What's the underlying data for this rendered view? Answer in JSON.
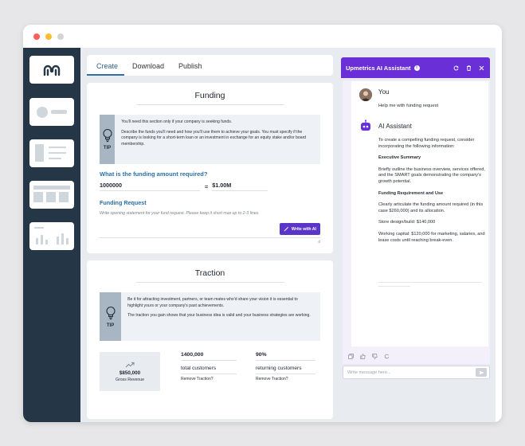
{
  "window": {
    "controls": [
      {
        "name": "close",
        "color": "#ff5f57"
      },
      {
        "name": "minimize",
        "color": "#febc2e"
      },
      {
        "name": "zoom",
        "color": "#d4d4d4"
      }
    ]
  },
  "tabs": [
    {
      "label": "Create",
      "active": true
    },
    {
      "label": "Download",
      "active": false
    },
    {
      "label": "Publish",
      "active": false
    }
  ],
  "funding": {
    "title": "Funding",
    "tip_label": "TIP",
    "tip_lines": [
      "You'll need this section only if your company is seeking funds.",
      "Describe the funds you'll need and how you'll use them to achieve your goals. You must specify if the company is looking for a short-term loan or an investment in exchange for an equity stake and/or board membership."
    ],
    "question": "What is the funding amount required?",
    "amount_value": "1000000",
    "amount_equals": "=",
    "amount_formatted": "$1.00M",
    "request_label": "Funding Request",
    "request_placeholder": "Write opening statement for your fund request. Please keep it short max up to 2-3 lines.",
    "write_ai_label": "Write with AI",
    "char_count": "0"
  },
  "traction": {
    "title": "Traction",
    "tip_label": "TIP",
    "tip_lines": [
      "Be it for attracting investment, partners, or team mates who'd share your vision it is essential to highlight yours or your company's past achievements.",
      "The traction you gain shows that your business idea is valid and your business strategies are working."
    ],
    "gross_revenue_value": "$850,000",
    "gross_revenue_label": "Gross Revenue",
    "metrics": [
      {
        "value": "1400,000",
        "label": "total customers",
        "remove": "Remove Traction?"
      },
      {
        "value": "90%",
        "label": "returning customers",
        "remove": "Remove Traction?"
      }
    ]
  },
  "assistant": {
    "title": "Upmetrics AI Assistant",
    "info_icon": "i",
    "accent": "#6a2fd6",
    "user_name": "You",
    "user_message": "Help me with funding request",
    "bot_name": "AI Assistant",
    "response": {
      "intro": "To create a compelling funding request, consider incorporating the following information:",
      "heading1": "Executive Summary",
      "para1": "Briefly outline the business overview, services offered, and the SMART goals demonstrating the company's growth potential.",
      "heading2": "Funding Requirement and Use",
      "para2": "Clearly articulate the funding amount required (in this case $260,000) and its allocation.",
      "para3": "Store design/build: $140,000",
      "para4": "Working capital: $120,000 for marketing, salaries, and lease costs until reaching break-even."
    },
    "input_placeholder": "Write message here..."
  }
}
